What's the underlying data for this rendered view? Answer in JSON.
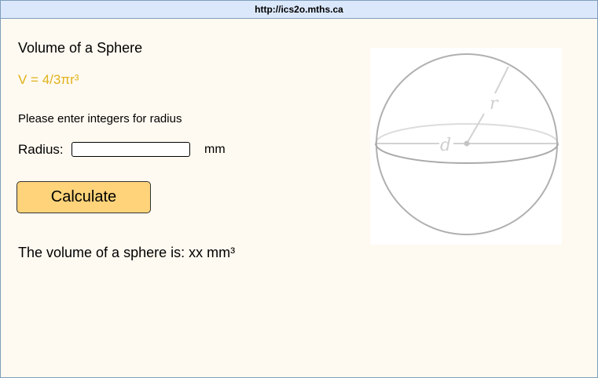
{
  "window": {
    "url": "http://ics2o.mths.ca"
  },
  "main": {
    "heading": "Volume of a Sphere",
    "formula": "V = 4/3πr³",
    "instructions": "Please enter integers for radius",
    "radius_label": "Radius:",
    "radius_value": "",
    "radius_placeholder": "",
    "unit_label": "mm",
    "calculate_label": "Calculate",
    "result_text": "The volume of a sphere is: xx mm³"
  },
  "diagram": {
    "radius_label": "r",
    "diameter_label": "d"
  },
  "colors": {
    "formula": "#e0b21c",
    "button_fill": "#ffd37a",
    "background": "#fffaf1",
    "titlebar": "#dbe8fb"
  }
}
